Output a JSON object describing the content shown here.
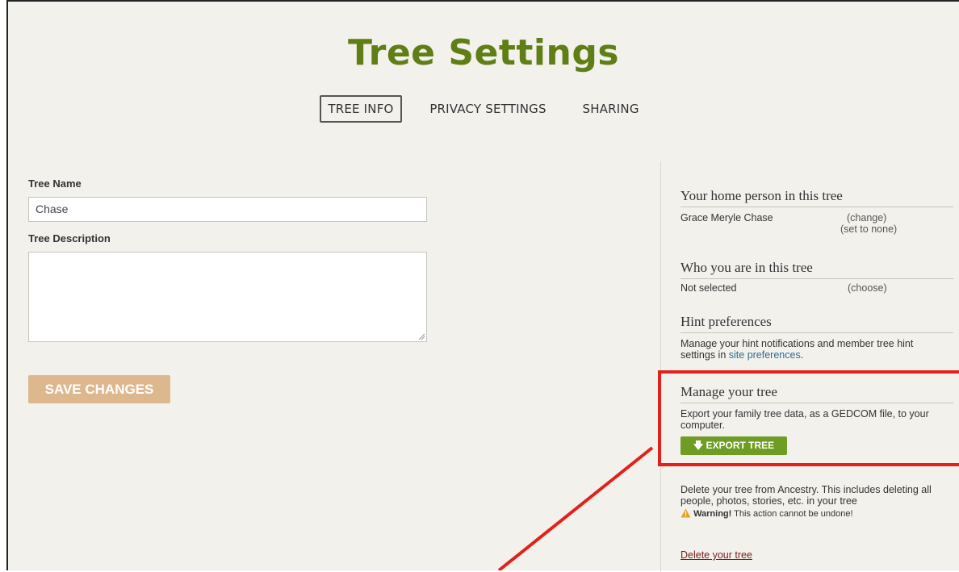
{
  "page": {
    "title": "Tree Settings"
  },
  "tabs": [
    {
      "label": "TREE INFO",
      "active": true
    },
    {
      "label": "PRIVACY SETTINGS",
      "active": false
    },
    {
      "label": "SHARING",
      "active": false
    }
  ],
  "form": {
    "tree_name_label": "Tree Name",
    "tree_name_value": "Chase",
    "tree_description_label": "Tree Description",
    "tree_description_value": "",
    "save_label": "SAVE CHANGES"
  },
  "sidebar": {
    "home_person": {
      "heading": "Your home person in this tree",
      "name": "Grace Meryle Chase",
      "change_link": "(change)",
      "set_none_link": "(set to none)"
    },
    "who_you_are": {
      "heading": "Who you are in this tree",
      "status": "Not selected",
      "choose_link": "(choose)"
    },
    "hints": {
      "heading": "Hint preferences",
      "text": "Manage your hint notifications and member tree hint settings in",
      "link": "site preferences",
      "after_link": "."
    },
    "manage": {
      "heading": "Manage your tree",
      "text": "Export your family tree data, as a GEDCOM file, to your computer.",
      "export_label": "EXPORT TREE",
      "delete_text": "Delete your tree from Ancestry. This includes deleting all people, photos, stories, etc. in your tree",
      "warning_bold": "Warning!",
      "warning_text": "This action cannot be undone!",
      "delete_link": "Delete your tree"
    }
  },
  "colors": {
    "title_green": "#5f7f16",
    "export_green": "#6f9c23",
    "save_tan": "#ddb88f",
    "highlight_red": "#e0221a",
    "background": "#f3f1ec"
  }
}
